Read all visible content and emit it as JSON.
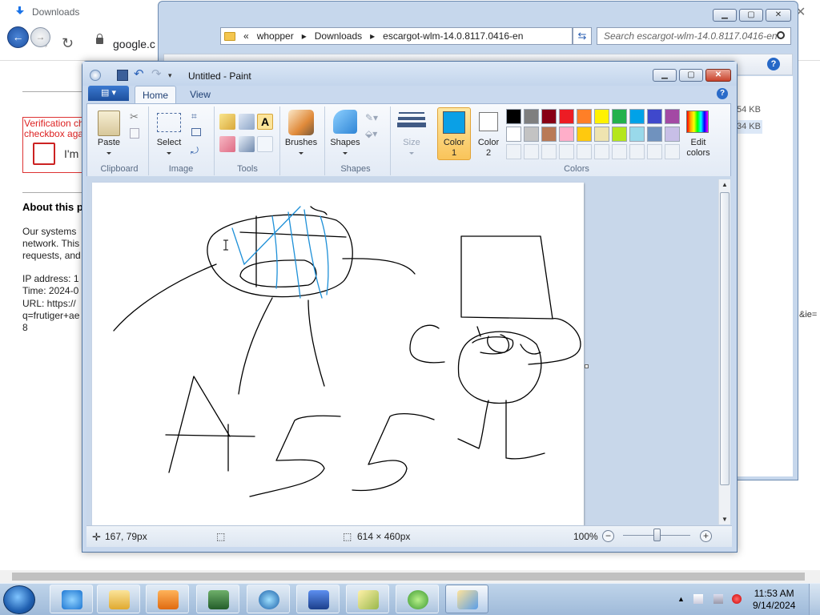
{
  "browser": {
    "tab_title": "Downloads",
    "close_glyph": "✕",
    "url_fragment": "google.c",
    "verification_line1": "Verification ch",
    "verification_line2": "checkbox aga",
    "checkbox_label": "I'm",
    "about_heading": "About this p",
    "body_lines": [
      "Our systems",
      "network. This",
      "requests, and"
    ],
    "ip_line": "IP address: 1",
    "time_line": "Time: 2024-0",
    "url_line": "URL: https://",
    "q_line": "q=frutiger+ae",
    "eight": "8",
    "right_fragment": "&ie="
  },
  "explorer": {
    "path": [
      "«",
      "whopper",
      "Downloads",
      "escargot-wlm-14.0.8117.0416-en"
    ],
    "search_placeholder": "Search escargot-wlm-14.0.8117.0416-en",
    "sizes": [
      "54 KB",
      "34 KB"
    ],
    "help": "?"
  },
  "paint": {
    "title": "Untitled - Paint",
    "tabs": [
      "Home",
      "View"
    ],
    "help": "?",
    "groups": {
      "clipboard": "Clipboard",
      "image": "Image",
      "tools": "Tools",
      "shapes": "Shapes",
      "colors": "Colors"
    },
    "buttons": {
      "paste": "Paste",
      "select": "Select",
      "brushes": "Brushes",
      "shapes": "Shapes",
      "size": "Size",
      "color1_a": "Color",
      "color1_b": "1",
      "color2_a": "Color",
      "color2_b": "2",
      "edit_colors_a": "Edit",
      "edit_colors_b": "colors"
    },
    "palette_row1": [
      "#000000",
      "#7f7f7f",
      "#880015",
      "#ed1c24",
      "#ff7f27",
      "#fff200",
      "#22b14c",
      "#00a2e8",
      "#3f48cc",
      "#a349a4"
    ],
    "palette_row2": [
      "#ffffff",
      "#c3c3c3",
      "#b97a57",
      "#ffaec9",
      "#ffc90e",
      "#efe4b0",
      "#b5e61d",
      "#99d9ea",
      "#7092be",
      "#c8bfe7"
    ],
    "color1": "#0aa0e6",
    "color2": "#ffffff",
    "status": {
      "cursor_pos": "167, 79px",
      "canvas_size": "614 × 460px",
      "zoom": "100%",
      "zoom_minus": "−",
      "zoom_plus": "+"
    }
  },
  "taskbar": {
    "time": "11:53 AM",
    "date": "9/14/2024"
  }
}
